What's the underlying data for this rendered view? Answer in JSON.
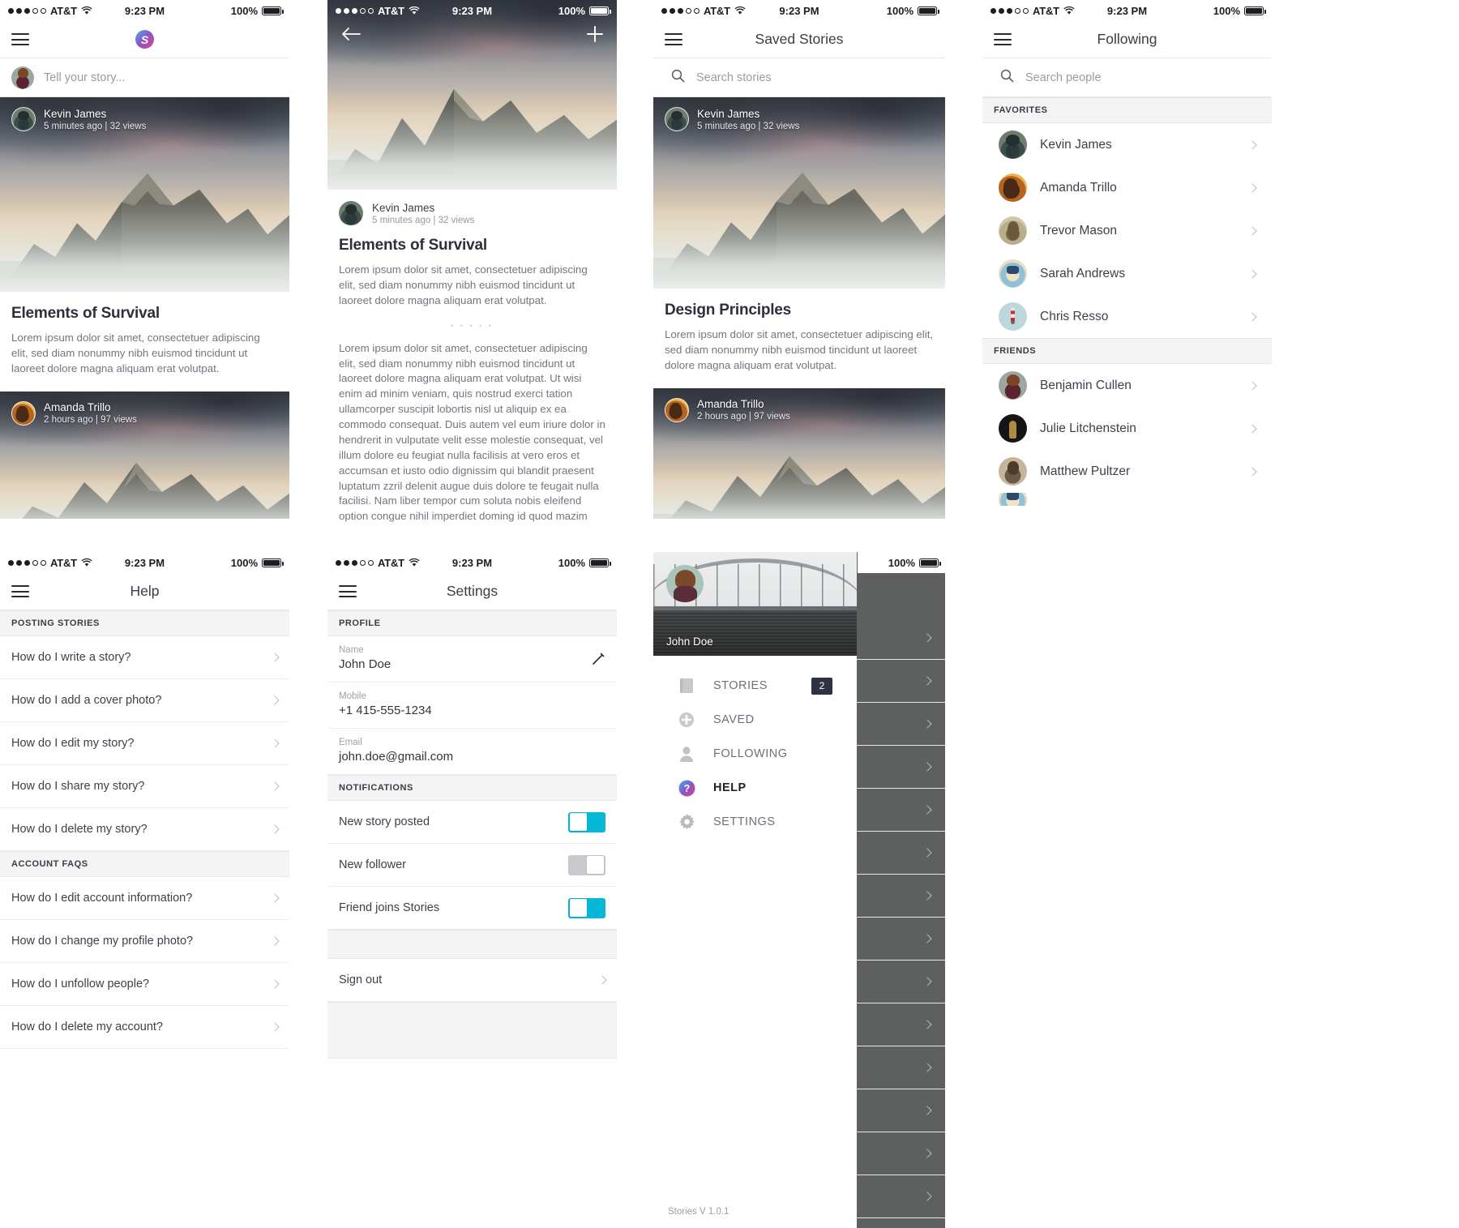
{
  "status_bar": {
    "signal_dots_filled": 3,
    "signal_dots_empty": 2,
    "carrier": "AT&T",
    "time": "9:23 PM",
    "battery": "100%"
  },
  "brand": {
    "logo_letter": "S",
    "accent": "#05b8d8",
    "logo_gradient": "#46b7e8 -> #8a56c8 -> #d8418e"
  },
  "screen_feed": {
    "compose_placeholder": "Tell your story...",
    "posts": [
      {
        "author": "Kevin James",
        "meta": "5 minutes ago   |   32 views",
        "title": "Elements of Survival",
        "excerpt": "Lorem ipsum dolor sit amet, consectetuer adipiscing elit, sed diam nonummy nibh euismod tincidunt ut laoreet dolore magna aliquam erat volutpat."
      },
      {
        "author": "Amanda Trillo",
        "meta": "2 hours ago   |   97 views",
        "title": "",
        "excerpt": ""
      }
    ]
  },
  "screen_story": {
    "back_icon": "arrow-left-icon",
    "add_icon": "plus-icon",
    "author": "Kevin James",
    "meta": "5 minutes ago   |   32 views",
    "title": "Elements of Survival",
    "lead": "Lorem ipsum dolor sit amet, consectetuer adipiscing elit, sed diam nonummy nibh euismod tincidunt ut laoreet dolore magna aliquam erat volutpat.",
    "divider": "• • • • •",
    "body": "Lorem ipsum dolor sit amet, consectetuer adipiscing elit, sed diam nonummy nibh euismod tincidunt ut laoreet dolore magna aliquam erat volutpat. Ut wisi enim ad minim veniam, quis nostrud exerci tation ullamcorper suscipit lobortis nisl ut aliquip ex ea commodo consequat. Duis autem vel eum iriure dolor in hendrerit in vulputate velit esse molestie consequat, vel illum dolore eu feugiat nulla facilisis at vero eros et accumsan et iusto odio dignissim qui blandit praesent luptatum zzril delenit augue duis dolore te feugait nulla facilisi. Nam liber tempor cum soluta nobis eleifend option congue nihil imperdiet doming id quod mazim placerat facer possim assum. Typi non habent claritatem insitam; est usus legentis in iis qui facit eorum claritatem. Investigationes demonstraver unt lectores legere me lius quod ii legunt saepius."
  },
  "screen_saved": {
    "title": "Saved Stories",
    "search_placeholder": "Search stories",
    "posts": [
      {
        "author": "Kevin James",
        "meta": "5 minutes ago   |   32 views",
        "title": "Design Principles",
        "excerpt": "Lorem ipsum dolor sit amet, consectetuer adipiscing elit, sed diam nonummy nibh euismod tincidunt ut laoreet dolore magna aliquam erat volutpat."
      },
      {
        "author": "Amanda Trillo",
        "meta": "2 hours ago   |   97 views",
        "title": "",
        "excerpt": ""
      }
    ]
  },
  "screen_following": {
    "title": "Following",
    "search_placeholder": "Search people",
    "sections": [
      {
        "header": "FAVORITES",
        "people": [
          {
            "name": "Kevin James",
            "avatar": "av-kevin"
          },
          {
            "name": "Amanda Trillo",
            "avatar": "av-amanda"
          },
          {
            "name": "Trevor Mason",
            "avatar": "av-trevor"
          },
          {
            "name": "Sarah Andrews",
            "avatar": "av-sarah"
          },
          {
            "name": "Chris Resso",
            "avatar": "av-chris"
          }
        ]
      },
      {
        "header": "FRIENDS",
        "people": [
          {
            "name": "Benjamin Cullen",
            "avatar": "av-benjamin"
          },
          {
            "name": "Julie Litchenstein",
            "avatar": "av-julie"
          },
          {
            "name": "Matthew Pultzer",
            "avatar": "av-matthew"
          }
        ]
      }
    ]
  },
  "screen_help": {
    "title": "Help",
    "sections": [
      {
        "header": "POSTING STORIES",
        "items": [
          "How do I write a story?",
          "How do I add a cover photo?",
          "How do I edit my story?",
          "How do I share my story?",
          "How do I delete my story?"
        ]
      },
      {
        "header": "ACCOUNT FAQS",
        "items": [
          "How do I edit account information?",
          "How do I change my profile photo?",
          "How do I unfollow people?",
          "How do I delete my account?"
        ]
      }
    ]
  },
  "screen_settings": {
    "title": "Settings",
    "profile_header": "PROFILE",
    "fields": [
      {
        "label": "Name",
        "value": "John Doe",
        "edit_icon": "pencil-icon"
      },
      {
        "label": "Mobile",
        "value": "+1 415-555-1234"
      },
      {
        "label": "Email",
        "value": "john.doe@gmail.com"
      }
    ],
    "notifications_header": "NOTIFICATIONS",
    "toggles": [
      {
        "label": "New story posted",
        "state": "on"
      },
      {
        "label": "New follower",
        "state": "off"
      },
      {
        "label": "Friend joins Stories",
        "state": "on"
      }
    ],
    "sign_out": "Sign out"
  },
  "screen_drawer": {
    "user_name": "John Doe",
    "items": [
      {
        "label": "STORIES",
        "icon": "book-icon",
        "badge": "2",
        "active": false
      },
      {
        "label": "SAVED",
        "icon": "plus-circle-icon",
        "badge": "",
        "active": false
      },
      {
        "label": "FOLLOWING",
        "icon": "person-icon",
        "badge": "",
        "active": false
      },
      {
        "label": "HELP",
        "icon": "question-circle-icon",
        "badge": "",
        "active": true
      },
      {
        "label": "SETTINGS",
        "icon": "gear-icon",
        "badge": "",
        "active": false
      }
    ],
    "version": "Stories V 1.0.1"
  }
}
